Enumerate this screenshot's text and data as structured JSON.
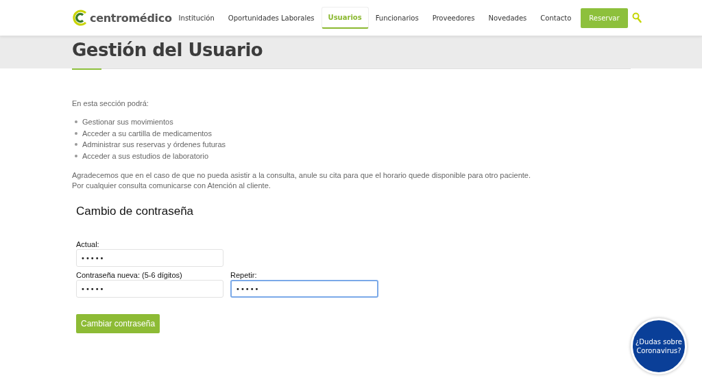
{
  "header": {
    "logo": "centromédico",
    "nav": [
      {
        "label": "Institución",
        "selected": false
      },
      {
        "label": "Oportunidades Laborales",
        "selected": false
      },
      {
        "label": "Usuarios",
        "selected": true
      },
      {
        "label": "Funcionarios",
        "selected": false
      },
      {
        "label": "Proveedores",
        "selected": false
      },
      {
        "label": "Novedades",
        "selected": false
      },
      {
        "label": "Contacto",
        "selected": false
      }
    ],
    "cta": "Reservar"
  },
  "page_title": "Gestión del Usuario",
  "intro": "En esta sección podrá:",
  "features": [
    "Gestionar sus movimientos",
    "Acceder a su cartilla de medicamentos",
    "Administrar sus reservas y órdenes futuras",
    "Acceder a sus estudios de laboratorio"
  ],
  "notes": [
    "Agradecemos que en el caso de que no pueda asistir a la consulta, anule su cita para que el horario quede disponible para otro paciente.",
    "Por cualquier consulta comunicarse con Atención al cliente."
  ],
  "form": {
    "title": "Cambio de contraseña",
    "fields": [
      {
        "label": "Actual:",
        "value": "•••••",
        "focused": false
      },
      {
        "label": "Contraseña nueva: (5-6 dígitos)",
        "value": "•••••",
        "focused": false
      },
      {
        "label": "Repetir:",
        "value": "•••••",
        "focused": true
      }
    ],
    "submit": "Cambiar contraseña"
  },
  "floating_badge": "¿Dudas sobre Coronavirus?"
}
